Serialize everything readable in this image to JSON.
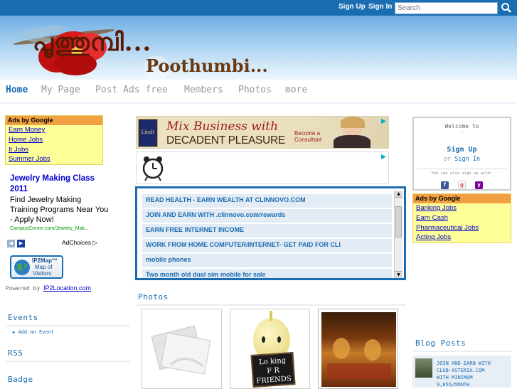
{
  "topbar": {
    "signup": "Sign Up",
    "signin": "Sign In",
    "search_placeholder": "Search"
  },
  "site": {
    "title_malayalam": "പൂത്തുമ്പി...",
    "title_english": "Poothumbi..."
  },
  "nav": {
    "items": [
      "Home",
      "My Page",
      "Post Ads free",
      "Members",
      "Photos",
      "more"
    ],
    "active": "Home"
  },
  "left_ads": {
    "header": "Ads by Google",
    "links": [
      "Earn Money",
      "Home Jobs",
      "It Jobs",
      "Summer Jobs"
    ]
  },
  "jewelry_ad": {
    "title": "Jewelry Making Class 2011",
    "text": "Find Jewelry Making Training Programs Near You - Apply Now!",
    "url": "CampusCorner.com/Jewelry_Mak..."
  },
  "adchoices": "AdChoices",
  "ip2map": {
    "line1": "IP2Map™",
    "line2": "Map of",
    "line3": "Visitors"
  },
  "powered_by": {
    "prefix": "Powered by",
    "link": "IP2Location.com"
  },
  "left_sections": {
    "events": "Events",
    "add_event": "Add an Event",
    "rss": "RSS",
    "badge": "Badge"
  },
  "banner1": {
    "brand": "Lindt",
    "headline1": "Mix Business with",
    "headline2": "DECADENT PLEASURE",
    "cta1": "Become a",
    "cta2": "Consultant"
  },
  "link_list": [
    "READ HEALTH - EARN WEALTH AT CLINNOVO.COM",
    "JOIN AND EARN WITH .clinnovo.com/rewards",
    "EARN FREE INTERNET INCOME",
    "WORK FROM HOME COMPUTER/INTERNET- GET PAID FOR CLI",
    "mobile phones",
    "Two month old dual sim mobile for sale"
  ],
  "photos": {
    "title": "Photos",
    "sign_line1": "Lo king",
    "sign_line2": "F R",
    "sign_line3": "FRIENDS"
  },
  "welcome": {
    "line1": "Welcome to",
    "line1b": "·",
    "signup": "Sign Up",
    "or_prefix": "or",
    "signin": "Sign In",
    "also": "You can also sign up with:"
  },
  "right_ads": {
    "header": "Ads by Google",
    "links": [
      "Banking Jobs",
      "Earn Cash",
      "Pharmaceutical Jobs",
      "Acting Jobs"
    ]
  },
  "blog": {
    "title": "Blog Posts",
    "item_line1": "JOIN AND EARN WITH",
    "item_line2": "CLUB-ASTERIA.COM",
    "item_line3": "WITH MINIMUM",
    "item_line4": "9,855/MONTH"
  },
  "colors": {
    "accent": "#1a6db1",
    "ad_yellow": "#ffff99",
    "ad_header": "#f0a040",
    "link_blue": "#0000cc"
  }
}
